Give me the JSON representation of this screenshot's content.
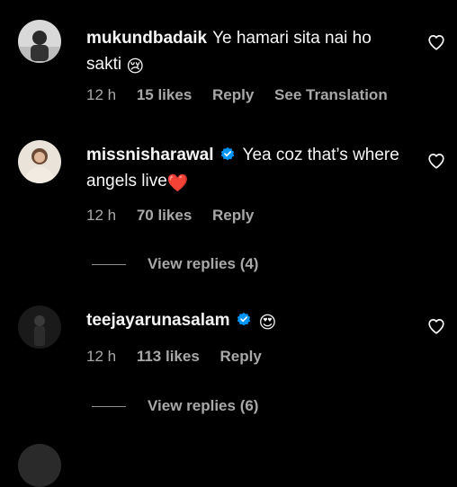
{
  "comments": [
    {
      "username": "mukundbadaik",
      "verified": false,
      "text": "Ye hamari sita nai ho sakti",
      "emoji": "😢",
      "time": "12 h",
      "likes": "15 likes",
      "reply": "Reply",
      "translate": "See Translation"
    },
    {
      "username": "missnisharawal",
      "verified": true,
      "text": "Yea coz that’s where angels live",
      "emoji": "❤️",
      "time": "12 h",
      "likes": "70 likes",
      "reply": "Reply",
      "view_replies": "View replies (4)"
    },
    {
      "username": "teejayarunasalam",
      "verified": true,
      "text": "",
      "emoji": "😍",
      "time": "12 h",
      "likes": "113 likes",
      "reply": "Reply",
      "view_replies": "View replies (6)"
    }
  ],
  "icons": {
    "like": "heart-outline-icon",
    "verified": "verified-badge-icon"
  },
  "colors": {
    "background": "#000000",
    "text": "#f5f5f5",
    "meta": "#a8a8a8",
    "verified": "#0095f6"
  }
}
